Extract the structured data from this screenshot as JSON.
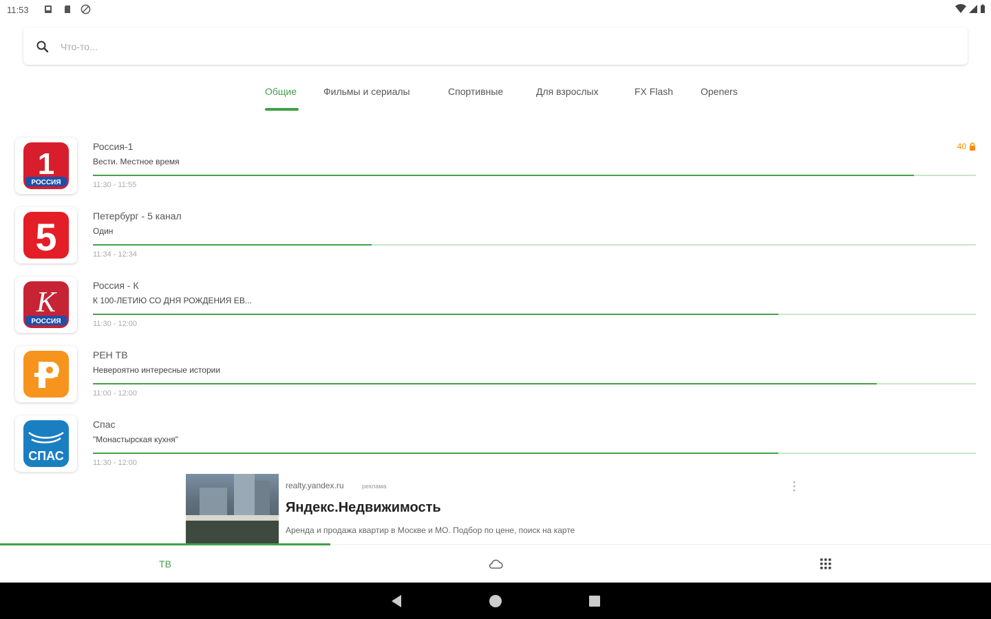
{
  "status_bar": {
    "time": "11:53"
  },
  "search": {
    "placeholder": "Что-то..."
  },
  "tabs": [
    {
      "label": "Общие",
      "active": true
    },
    {
      "label": "Фильмы и сериалы"
    },
    {
      "label": "Спортивные"
    },
    {
      "label": "Для взрослых"
    },
    {
      "label": "FX Flash"
    },
    {
      "label": "Openers"
    }
  ],
  "channels": [
    {
      "name": "Россия-1",
      "program": "Вести. Местное время",
      "time": "11:30 - 11:55",
      "progress": 0.93,
      "badge": "40",
      "logo": "russia-1",
      "color": "#d81e2c"
    },
    {
      "name": "Петербург - 5 канал",
      "program": "Один",
      "time": "11:34 - 12:34",
      "progress": 0.316,
      "logo": "channel-5",
      "color": "#e41e26"
    },
    {
      "name": "Россия - К",
      "program": "К 100-ЛЕТИЮ СО ДНЯ РОЖДЕНИЯ ЕВ...",
      "time": "11:30 - 12:00",
      "progress": 0.776,
      "logo": "russia-k",
      "color": "#c62334"
    },
    {
      "name": "РЕН ТВ",
      "program": "Невероятно интересные истории",
      "time": "11:00 - 12:00",
      "progress": 0.888,
      "logo": "ren-tv",
      "color": "#f7941d"
    },
    {
      "name": "Спас",
      "program": "\"Монастырская кухня\"",
      "time": "11:30 - 12:00",
      "progress": 0.776,
      "logo": "spas",
      "color": "#1a7fc1"
    }
  ],
  "ad": {
    "domain": "realty.yandex.ru",
    "label": "реклама",
    "title": "Яндекс.Недвижимость",
    "description": "Аренда и продажа квартир в Москве и МО. Подбор по цене, поиск на карте"
  },
  "bottom_nav": {
    "tv_label": "ТВ"
  },
  "colors": {
    "accent": "#43a047",
    "badge": "#fb8c00"
  }
}
